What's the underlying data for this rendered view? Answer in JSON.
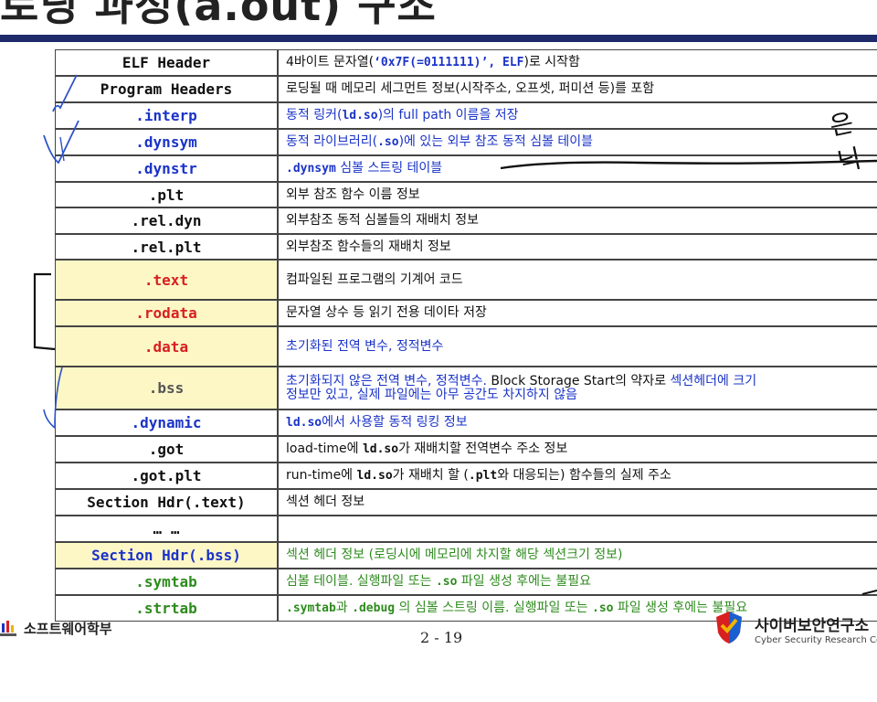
{
  "title": "로딩 과정(a.out) 구조",
  "rows": [
    {
      "section": "ELF Header",
      "section_color": "black",
      "highlight": false,
      "desc_color": "black",
      "desc": [
        {
          "t": "4바이트 문자열("
        },
        {
          "t": "‘0x7F(=0111111)’, ELF",
          "code": true,
          "color": "blue"
        },
        {
          "t": ")로 시작함"
        }
      ]
    },
    {
      "section": "Program Headers",
      "section_color": "black",
      "highlight": false,
      "desc_color": "black",
      "desc": [
        {
          "t": "로딩될 때 메모리 세그먼트 정보(시작주소, 오프셋, 퍼미션 등)를 포함"
        }
      ]
    },
    {
      "section": ".interp",
      "section_color": "blue",
      "highlight": false,
      "desc_color": "blue",
      "desc": [
        {
          "t": "동적 링커("
        },
        {
          "t": "ld.so",
          "code": true
        },
        {
          "t": ")의 full path 이름을 저장"
        }
      ]
    },
    {
      "section": ".dynsym",
      "section_color": "blue",
      "highlight": false,
      "desc_color": "blue",
      "desc": [
        {
          "t": "동적 라이브러리("
        },
        {
          "t": ".so",
          "code": true
        },
        {
          "t": ")에 있는 외부 참조 동적 심볼 테이블"
        }
      ]
    },
    {
      "section": ".dynstr",
      "section_color": "blue",
      "highlight": false,
      "desc_color": "blue",
      "desc": [
        {
          "t": ".dynsym",
          "code": true
        },
        {
          "t": " 심볼 스트링 테이블"
        }
      ]
    },
    {
      "section": ".plt",
      "section_color": "black",
      "highlight": false,
      "desc_color": "black",
      "desc": [
        {
          "t": "외부 참조 함수 이름 정보"
        }
      ]
    },
    {
      "section": ".rel.dyn",
      "section_color": "black",
      "highlight": false,
      "desc_color": "black",
      "desc": [
        {
          "t": "외부참조 동적 심볼들의 재배치 정보"
        }
      ]
    },
    {
      "section": ".rel.plt",
      "section_color": "black",
      "highlight": false,
      "desc_color": "black",
      "desc": [
        {
          "t": "외부참조 함수들의 재배치 정보"
        }
      ]
    },
    {
      "section": ".text",
      "section_color": "red",
      "highlight": true,
      "desc_color": "black",
      "desc": [
        {
          "t": "컴파일된 프로그램의 기계어 코드"
        }
      ]
    },
    {
      "section": ".rodata",
      "section_color": "red",
      "highlight": true,
      "desc_color": "black",
      "desc": [
        {
          "t": "문자열 상수 등 읽기 전용 데이타 저장"
        }
      ]
    },
    {
      "section": ".data",
      "section_color": "red",
      "highlight": true,
      "desc_color": "blue",
      "desc": [
        {
          "t": "초기화된 전역 변수, 정적변수"
        }
      ]
    },
    {
      "section": ".bss",
      "section_color": "gray",
      "highlight": true,
      "desc_color": "blue",
      "desc": [
        {
          "t": "초기화되지 않은 전역 변수, 정적변수.  "
        },
        {
          "t": "Block Storage Start의 약자로 ",
          "color": "black"
        },
        {
          "t": "섹션헤더에 크기"
        },
        {
          "br": true
        },
        {
          "t": "정보만 있고, 실제 파일에는 아무 공간도 차지하지 않음"
        }
      ]
    },
    {
      "section": ".dynamic",
      "section_color": "blue",
      "highlight": false,
      "desc_color": "blue",
      "desc": [
        {
          "t": "ld.so",
          "code": true
        },
        {
          "t": "에서 사용할 동적 링킹 정보"
        }
      ]
    },
    {
      "section": ".got",
      "section_color": "black",
      "highlight": false,
      "desc_color": "black",
      "desc": [
        {
          "t": "load-time에 "
        },
        {
          "t": "ld.so",
          "code": true
        },
        {
          "t": "가 재배치할 전역변수 주소 정보"
        }
      ]
    },
    {
      "section": ".got.plt",
      "section_color": "black",
      "highlight": false,
      "desc_color": "black",
      "desc": [
        {
          "t": "run-time에 "
        },
        {
          "t": "ld.so",
          "code": true
        },
        {
          "t": "가 재배치 할 ("
        },
        {
          "t": ".plt",
          "code": true
        },
        {
          "t": "와 대응되는) 함수들의 실제 주소"
        }
      ]
    },
    {
      "section": "Section Hdr(.text)",
      "section_color": "black",
      "highlight": false,
      "desc_color": "black",
      "desc": [
        {
          "t": "섹션 헤더 정보"
        }
      ]
    },
    {
      "section": "… …",
      "section_color": "black",
      "highlight": false,
      "desc_color": "black",
      "desc": []
    },
    {
      "section": "Section Hdr(.bss)",
      "section_color": "blue",
      "highlight": true,
      "desc_color": "green",
      "desc": [
        {
          "t": "섹션 헤더 정보 (로딩시에 메모리에 차지할 해당 섹션크기 정보)"
        }
      ]
    },
    {
      "section": ".symtab",
      "section_color": "green",
      "highlight": false,
      "desc_color": "green",
      "desc": [
        {
          "t": "심볼 테이블.  실행파일 또는 "
        },
        {
          "t": ".so",
          "code": true
        },
        {
          "t": " 파일 생성 후에는 불필요"
        }
      ]
    },
    {
      "section": ".strtab",
      "section_color": "green",
      "highlight": false,
      "desc_color": "green",
      "desc": [
        {
          "t": ".symtab",
          "code": true
        },
        {
          "t": "과 "
        },
        {
          "t": ".debug",
          "code": true
        },
        {
          "t": " 의 심볼 스트링 이름. 실행파일 또는 "
        },
        {
          "t": ".so",
          "code": true
        },
        {
          "t": " 파일 생성 후에는 불필요"
        }
      ]
    }
  ],
  "handwritten_note": "은닉",
  "footer": {
    "left_label": "소프트웨어학부",
    "page_number": "2 - 19",
    "right_main": "사이버보안연구소",
    "right_sub": "Cyber Security Research Center"
  },
  "colors": {
    "black": "#111111",
    "blue": "#1a33c8",
    "red": "#d92020",
    "gray": "#555555",
    "green": "#2e8b1e",
    "highlight": "#fdf7c6",
    "bar": "#1f2a6b"
  }
}
